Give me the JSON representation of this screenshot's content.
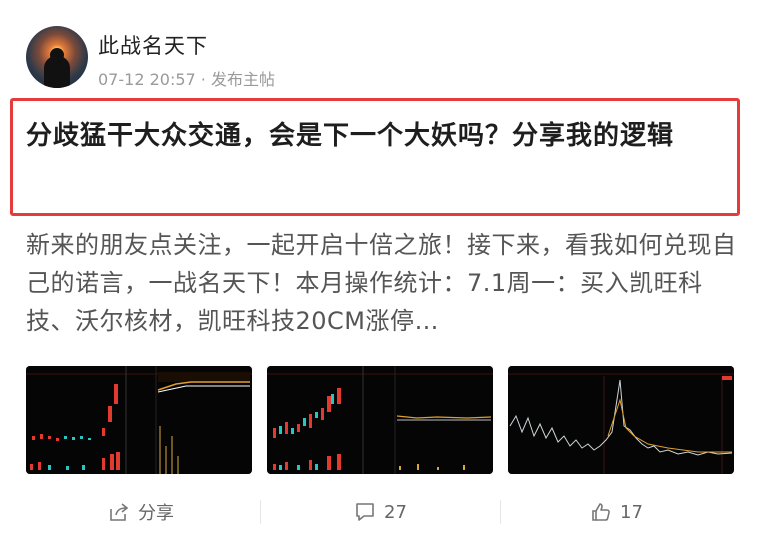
{
  "user": {
    "name": "此战名天下",
    "meta": "07-12 20:57 · 发布主帖"
  },
  "post": {
    "title": "分歧猛干大众交通，会是下一个大妖吗？分享我的逻辑",
    "body": "新来的朋友点关注，一起开启十倍之旅！接下来，看我如何兑现自己的诺言，一战名天下！本月操作统计：7.1周一：买入凯旺科技、沃尔核材，凯旺科技20CM涨停…"
  },
  "images": [
    {
      "name": "chart-thumbnail-1"
    },
    {
      "name": "chart-thumbnail-2"
    },
    {
      "name": "chart-thumbnail-3"
    }
  ],
  "actions": {
    "share_label": "分享",
    "comment_count": "27",
    "like_count": "17"
  },
  "icons": {
    "share": "share-icon",
    "comment": "comment-icon",
    "like": "thumbs-up-icon"
  },
  "colors": {
    "highlight_border": "#e43b3b"
  }
}
